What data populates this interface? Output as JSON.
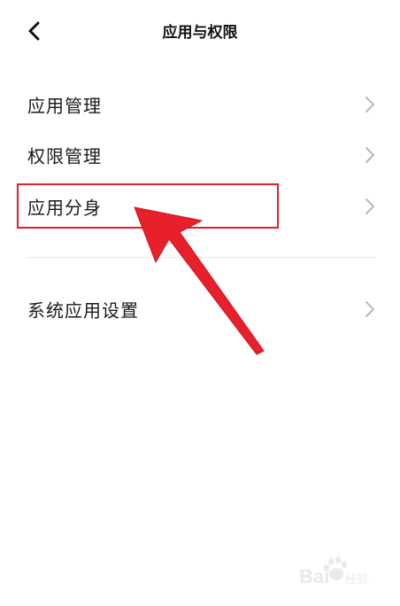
{
  "header": {
    "title": "应用与权限",
    "back_icon": "chevron-left-icon"
  },
  "menu": {
    "items": [
      {
        "label": "应用管理",
        "icon": "chevron-right-icon"
      },
      {
        "label": "权限管理",
        "icon": "chevron-right-icon"
      },
      {
        "label": "应用分身",
        "icon": "chevron-right-icon",
        "highlighted": true
      },
      {
        "label": "系统应用设置",
        "icon": "chevron-right-icon"
      }
    ]
  },
  "annotation": {
    "color": "#e0202c",
    "arrow_icon": "red-arrow-annotation"
  },
  "watermark": {
    "brand": "Bai",
    "sub": "经验"
  },
  "colors": {
    "text": "#1a1a1a",
    "chevron": "#b8b8b8",
    "divider": "#e9e9e9",
    "highlight": "#e0202c"
  }
}
